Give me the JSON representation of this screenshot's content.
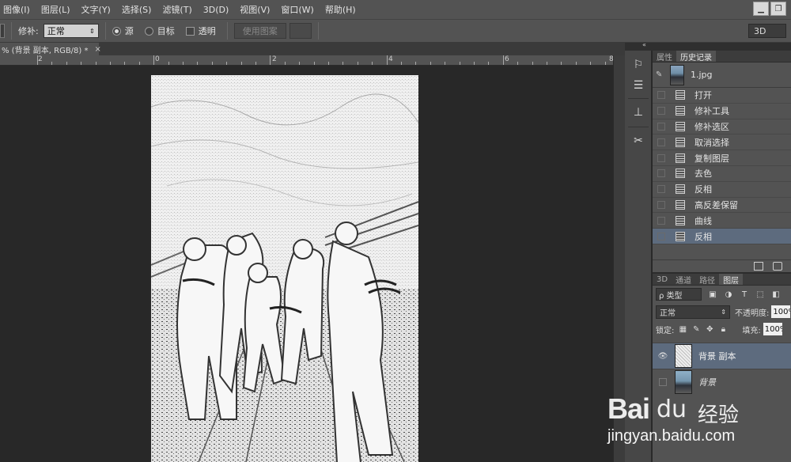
{
  "menu": [
    "图像(I)",
    "图层(L)",
    "文字(Y)",
    "选择(S)",
    "滤镜(T)",
    "3D(D)",
    "视图(V)",
    "窗口(W)",
    "帮助(H)"
  ],
  "options": {
    "tool_preset_icon": "patch-tool-icon",
    "repair_label": "修补:",
    "repair_mode": "正常",
    "source_label": "源",
    "target_label": "目标",
    "transparent_label": "透明",
    "use_pattern_label": "使用图案",
    "workspace": "3D"
  },
  "document": {
    "tab_title": "% (背景 副本, RGB/8) *",
    "close": "×",
    "ruler_labels": [
      "2",
      "0",
      "2",
      "4",
      "6",
      "8"
    ]
  },
  "tools": [
    "brush-icon",
    "adjust-sliders-icon",
    "clone-stamp-icon",
    "crossed-tools-icon"
  ],
  "history": {
    "tabs": [
      "属性",
      "历史记录"
    ],
    "active_tab": "历史记录",
    "snapshot": "1.jpg",
    "items": [
      "打开",
      "修补工具",
      "修补选区",
      "取消选择",
      "复制图层",
      "去色",
      "反相",
      "高反差保留",
      "曲线",
      "反相"
    ],
    "selected_index": 9
  },
  "layers": {
    "tabs": [
      "3D",
      "通道",
      "路径",
      "图层"
    ],
    "active_tab": "图层",
    "filter_label": "ρ 类型",
    "blend_mode": "正常",
    "opacity_label": "不透明度:",
    "opacity_value": "100%",
    "lock_label": "锁定:",
    "fill_label": "填充:",
    "fill_value": "100%",
    "list": [
      {
        "name": "背景 副本",
        "visible": true,
        "selected": true
      },
      {
        "name": "背景",
        "visible": false,
        "selected": false
      }
    ]
  },
  "watermark": {
    "logo": "Bai",
    "brand": "经验",
    "url": "jingyan.baidu.com"
  }
}
